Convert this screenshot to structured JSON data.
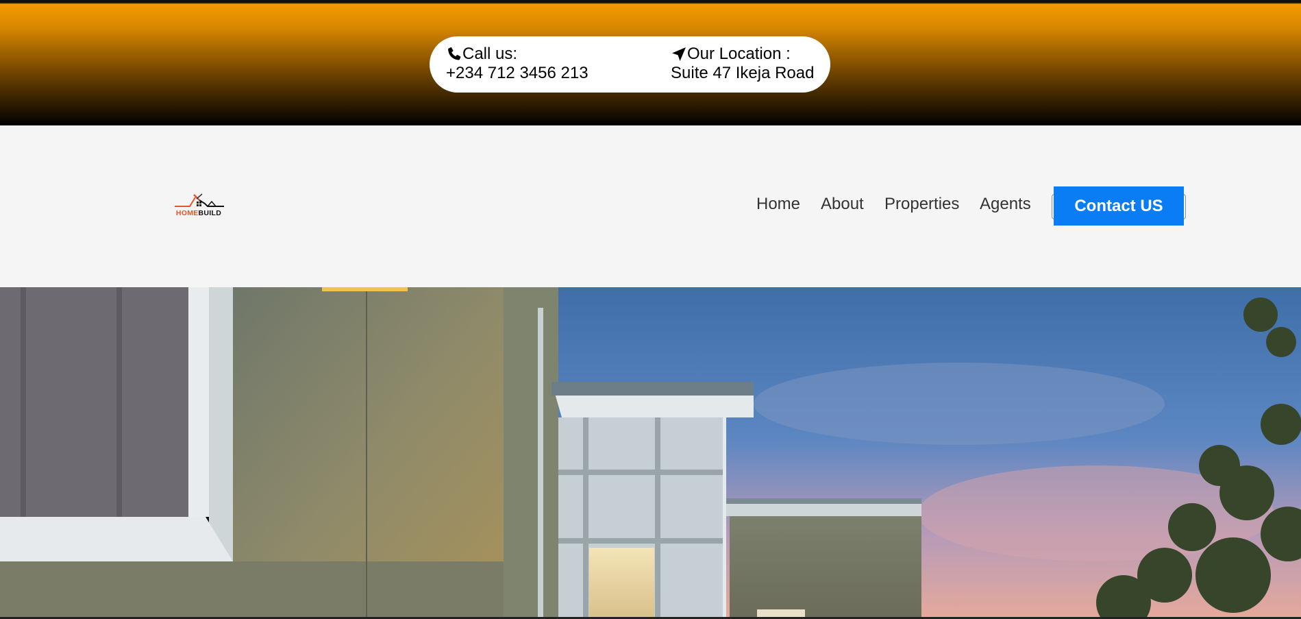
{
  "contact": {
    "call_label": "Call us:",
    "call_value": "+234 712 3456 213",
    "call_icon": "phone-icon",
    "location_label": "Our Location :",
    "location_value": "Suite 47 Ikeja Road",
    "location_icon": "location-arrow-icon"
  },
  "logo": {
    "word_home": "HOME",
    "word_build": "BUILD"
  },
  "nav": {
    "items": [
      {
        "label": "Home"
      },
      {
        "label": "About"
      },
      {
        "label": "Properties"
      },
      {
        "label": "Agents"
      }
    ],
    "cta_label": "Contact US"
  },
  "colors": {
    "topbar_orange": "#f39c00",
    "cta_blue": "#0a7df4",
    "navbar_bg": "#f4f5f4",
    "logo_orange": "#e8542a"
  }
}
